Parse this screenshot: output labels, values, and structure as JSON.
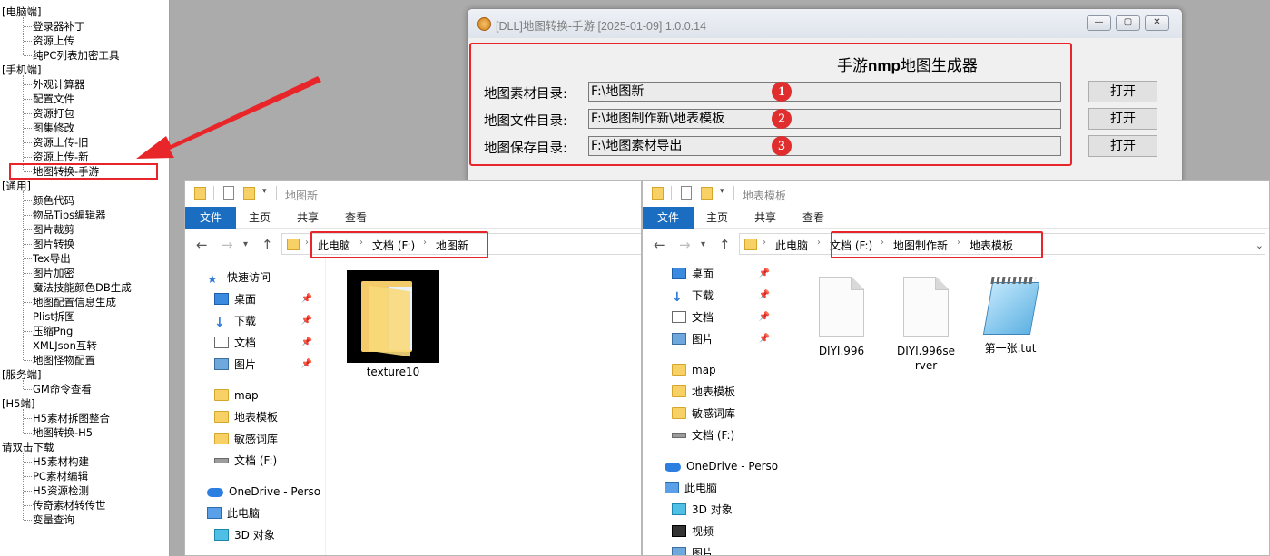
{
  "tree": {
    "groups": [
      {
        "label": "[电脑端]",
        "items": [
          "登录器补丁",
          "资源上传",
          "纯PC列表加密工具"
        ]
      },
      {
        "label": "[手机端]",
        "items": [
          "外观计算器",
          "配置文件",
          "资源打包",
          "图集修改",
          "资源上传-旧",
          "资源上传-新",
          "地图转换-手游"
        ]
      },
      {
        "label": "[通用]",
        "items": [
          "颜色代码",
          "物品Tips编辑器",
          "图片裁剪",
          "图片转换",
          "Tex导出",
          "图片加密",
          "魔法技能颜色DB生成",
          "地图配置信息生成",
          "Plist拆图",
          "压缩Png",
          "XMLJson互转",
          "地图怪物配置"
        ]
      },
      {
        "label": "[服务端]",
        "items": [
          "GM命令查看"
        ]
      },
      {
        "label": "[H5端]",
        "items": [
          "H5素材拆图整合",
          "地图转换-H5"
        ]
      },
      {
        "label": "请双击下载",
        "items": [
          "H5素材构建",
          "PC素材编辑",
          "H5资源检测",
          "传奇素材转传世",
          "变量查询"
        ]
      }
    ]
  },
  "app": {
    "title": "[DLL]地图转换-手游 [2025-01-09] 1.0.0.14",
    "heading_prefix": "手游",
    "heading_bold": "nmp",
    "heading_suffix": "地图生成器",
    "rows": [
      {
        "label": "地图素材目录:",
        "value": "F:\\地图新",
        "button": "打开",
        "badge": "1"
      },
      {
        "label": "地图文件目录:",
        "value": "F:\\地图制作新\\地表模板",
        "button": "打开",
        "badge": "2"
      },
      {
        "label": "地图保存目录:",
        "value": "F:\\地图素材导出",
        "button": "打开",
        "badge": "3"
      }
    ],
    "caption": {
      "minimize": "—",
      "maximize": "▢",
      "close": "✕"
    }
  },
  "explorer_left": {
    "window_title": "地图新",
    "ribbon": {
      "file": "文件",
      "tabs": [
        "主页",
        "共享",
        "查看"
      ]
    },
    "breadcrumbs": [
      "此电脑",
      "文档 (F:)",
      "地图新"
    ],
    "nav": [
      {
        "label": "快速访问",
        "icon": "star-icon",
        "pin": false
      },
      {
        "label": "桌面",
        "icon": "desktop-icon",
        "pin": true
      },
      {
        "label": "下载",
        "icon": "download-icon",
        "pin": true
      },
      {
        "label": "文档",
        "icon": "document-icon",
        "pin": true
      },
      {
        "label": "图片",
        "icon": "pictures-icon",
        "pin": true
      },
      {
        "label": "map",
        "icon": "folder-icon",
        "pin": false
      },
      {
        "label": "地表模板",
        "icon": "folder-icon",
        "pin": false
      },
      {
        "label": "敏感词库",
        "icon": "folder-icon",
        "pin": false
      },
      {
        "label": "文档 (F:)",
        "icon": "drive-icon",
        "pin": false
      },
      {
        "label": "OneDrive - Perso",
        "icon": "cloud-icon",
        "pin": false
      },
      {
        "label": "此电脑",
        "icon": "pc-icon",
        "pin": false
      },
      {
        "label": "3D 对象",
        "icon": "3d-objects-icon",
        "pin": false
      }
    ],
    "files": [
      {
        "name": "texture10",
        "icon": "folder-icon"
      }
    ]
  },
  "explorer_right": {
    "window_title": "地表模板",
    "ribbon": {
      "file": "文件",
      "tabs": [
        "主页",
        "共享",
        "查看"
      ]
    },
    "breadcrumbs": [
      "此电脑",
      "文档 (F:)",
      "地图制作新",
      "地表模板"
    ],
    "nav": [
      {
        "label": "桌面",
        "icon": "desktop-icon",
        "pin": true
      },
      {
        "label": "下载",
        "icon": "download-icon",
        "pin": true
      },
      {
        "label": "文档",
        "icon": "document-icon",
        "pin": true
      },
      {
        "label": "图片",
        "icon": "pictures-icon",
        "pin": true
      },
      {
        "label": "map",
        "icon": "folder-icon",
        "pin": false
      },
      {
        "label": "地表模板",
        "icon": "folder-icon",
        "pin": false
      },
      {
        "label": "敏感词库",
        "icon": "folder-icon",
        "pin": false
      },
      {
        "label": "文档 (F:)",
        "icon": "drive-icon",
        "pin": false
      },
      {
        "label": "OneDrive - Perso",
        "icon": "cloud-icon",
        "pin": false
      },
      {
        "label": "此电脑",
        "icon": "pc-icon",
        "pin": false
      },
      {
        "label": "3D 对象",
        "icon": "3d-objects-icon",
        "pin": false
      },
      {
        "label": "视频",
        "icon": "video-icon",
        "pin": false
      },
      {
        "label": "图片",
        "icon": "pictures-icon",
        "pin": false
      }
    ],
    "files": [
      {
        "name": "DIYI.996",
        "icon": "file-icon"
      },
      {
        "name": "DIYI.996server",
        "icon": "file-icon"
      },
      {
        "name": "第一张.tut",
        "icon": "notepad-icon"
      }
    ]
  },
  "colors": {
    "highlight_red": "#e8262a",
    "ribbon_blue": "#1a6dc1",
    "badge_red": "#e02d2d"
  }
}
